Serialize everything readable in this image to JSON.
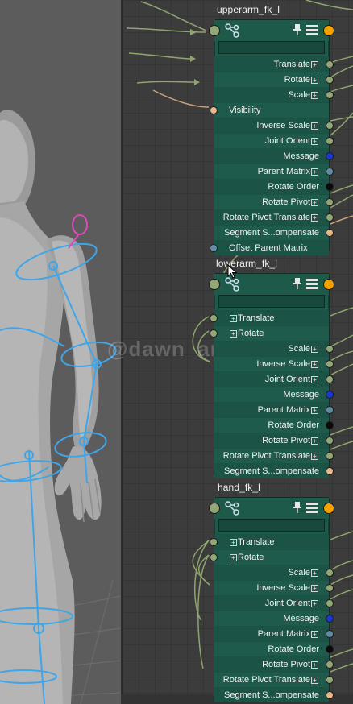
{
  "nodes": [
    {
      "title": "upperarm_fk_l",
      "attributes": [
        {
          "label": "Translate",
          "plus": true,
          "align": "right",
          "port": "green"
        },
        {
          "label": "Rotate",
          "plus": true,
          "align": "right",
          "port": "green"
        },
        {
          "label": "Scale",
          "plus": true,
          "align": "right",
          "port": "green"
        },
        {
          "label": "Visibility",
          "plus": false,
          "align": "left",
          "port": "orange"
        },
        {
          "label": "Inverse Scale",
          "plus": true,
          "align": "right",
          "port": "green"
        },
        {
          "label": "Joint Orient",
          "plus": true,
          "align": "right",
          "port": "green"
        },
        {
          "label": "Message",
          "plus": false,
          "align": "right",
          "port": "blue"
        },
        {
          "label": "Parent Matrix",
          "plus": true,
          "align": "right",
          "port": "steel"
        },
        {
          "label": "Rotate Order",
          "plus": false,
          "align": "right",
          "port": "black"
        },
        {
          "label": "Rotate Pivot",
          "plus": true,
          "align": "right",
          "port": "green"
        },
        {
          "label": "Rotate Pivot Translate",
          "plus": true,
          "align": "right",
          "port": "green"
        },
        {
          "label": "Segment S...ompensate",
          "plus": false,
          "align": "right",
          "port": "orange"
        },
        {
          "label": "Offset Parent Matrix",
          "plus": false,
          "align": "left",
          "port": "steel"
        }
      ]
    },
    {
      "title": "lowerarm_fk_l",
      "attributes": [
        {
          "label": "Translate",
          "plus": true,
          "align": "left",
          "port": "green"
        },
        {
          "label": "Rotate",
          "plus": true,
          "align": "left",
          "port": "green"
        },
        {
          "label": "Scale",
          "plus": true,
          "align": "right",
          "port": "green"
        },
        {
          "label": "Inverse Scale",
          "plus": true,
          "align": "right",
          "port": "green"
        },
        {
          "label": "Joint Orient",
          "plus": true,
          "align": "right",
          "port": "green"
        },
        {
          "label": "Message",
          "plus": false,
          "align": "right",
          "port": "blue"
        },
        {
          "label": "Parent Matrix",
          "plus": true,
          "align": "right",
          "port": "steel"
        },
        {
          "label": "Rotate Order",
          "plus": false,
          "align": "right",
          "port": "black"
        },
        {
          "label": "Rotate Pivot",
          "plus": true,
          "align": "right",
          "port": "green"
        },
        {
          "label": "Rotate Pivot Translate",
          "plus": true,
          "align": "right",
          "port": "green"
        },
        {
          "label": "Segment S...ompensate",
          "plus": false,
          "align": "right",
          "port": "orange"
        }
      ]
    },
    {
      "title": "hand_fk_l",
      "attributes": [
        {
          "label": "Translate",
          "plus": true,
          "align": "left",
          "port": "green"
        },
        {
          "label": "Rotate",
          "plus": true,
          "align": "left",
          "port": "green"
        },
        {
          "label": "Scale",
          "plus": true,
          "align": "right",
          "port": "green"
        },
        {
          "label": "Inverse Scale",
          "plus": true,
          "align": "right",
          "port": "green"
        },
        {
          "label": "Joint Orient",
          "plus": true,
          "align": "right",
          "port": "green"
        },
        {
          "label": "Message",
          "plus": false,
          "align": "right",
          "port": "blue"
        },
        {
          "label": "Parent Matrix",
          "plus": true,
          "align": "right",
          "port": "steel"
        },
        {
          "label": "Rotate Order",
          "plus": false,
          "align": "right",
          "port": "black"
        },
        {
          "label": "Rotate Pivot",
          "plus": true,
          "align": "right",
          "port": "green"
        },
        {
          "label": "Rotate Pivot Translate",
          "plus": true,
          "align": "right",
          "port": "green"
        },
        {
          "label": "Segment S...ompensate",
          "plus": false,
          "align": "right",
          "port": "orange"
        }
      ]
    }
  ],
  "watermark": "@dawn_arc",
  "icons": {
    "node_type": "joint-icon",
    "pin": "pin-icon",
    "attribute_list": "attribute-list-icon"
  },
  "colors": {
    "node_body": "#1e5a4a",
    "port_green": "#93a776",
    "port_orange_output": "#f5a100",
    "port_blue": "#1a38d8",
    "port_steel": "#5f8fa6",
    "port_peach": "#e7b98a",
    "wire": "#8fa46f",
    "joint_blue": "#3ea6e8",
    "control_pink": "#e04ab8"
  }
}
